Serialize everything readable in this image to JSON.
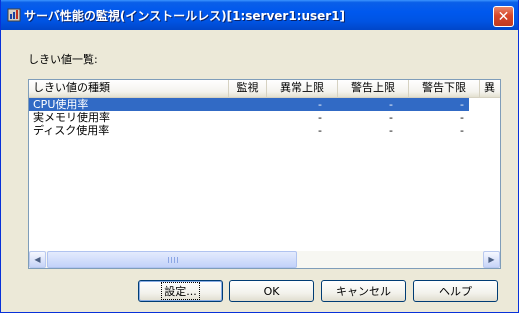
{
  "window": {
    "title": "サーバ性能の監視(インストールレス)[1:server1:user1]",
    "close_glyph": "✕"
  },
  "list_label": "しきい値一覧:",
  "columns": [
    "しきい値の種類",
    "監視",
    "異常上限",
    "警告上限",
    "警告下限",
    "異"
  ],
  "rows": [
    {
      "name": "CPU使用率",
      "monitor": "",
      "abnormal_upper": "-",
      "warning_upper": "-",
      "warning_lower": "-",
      "selected": true
    },
    {
      "name": "実メモリ使用率",
      "monitor": "",
      "abnormal_upper": "-",
      "warning_upper": "-",
      "warning_lower": "-",
      "selected": false
    },
    {
      "name": "ディスク使用率",
      "monitor": "",
      "abnormal_upper": "-",
      "warning_upper": "-",
      "warning_lower": "-",
      "selected": false
    }
  ],
  "scrollbar": {
    "left_arrow": "◀",
    "right_arrow": "▶"
  },
  "buttons": {
    "settings": "設定...",
    "ok": "OK",
    "cancel": "キャンセル",
    "help": "ヘルプ"
  },
  "colors": {
    "title_bar": "#0054e3",
    "selection": "#316ac5",
    "dialog_bg": "#ece9d8"
  }
}
